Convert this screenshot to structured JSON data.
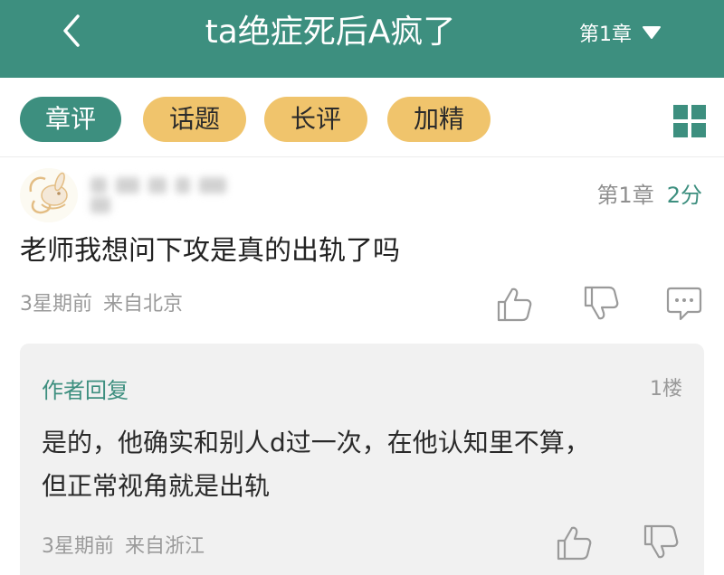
{
  "header": {
    "title": "ta绝症死后A疯了",
    "chapter_label": "第1章",
    "back_icon": "chevron-left-icon",
    "dropdown_icon": "caret-down-icon",
    "background_color": "#3d8f7f"
  },
  "filters": {
    "tabs": [
      {
        "label": "章评",
        "active": true
      },
      {
        "label": "话题",
        "active": false
      },
      {
        "label": "长评",
        "active": false
      },
      {
        "label": "加精",
        "active": false
      }
    ],
    "grid_icon": "grid-view-icon",
    "active_color": "#3d8f7f",
    "inactive_color": "#f0c46c"
  },
  "comment": {
    "chapter": "第1章",
    "score": "2分",
    "text": "老师我想问下攻是真的出轨了吗",
    "time": "3星期前",
    "location": "来自北京",
    "icons": [
      "thumbs-up-icon",
      "thumbs-down-icon",
      "comment-icon"
    ]
  },
  "reply": {
    "author_label": "作者回复",
    "floor": "1楼",
    "line1": "是的，他确实和别人d过一次，在他认知里不算，",
    "line2": "但正常视角就是出轨",
    "time": "3星期前",
    "location": "来自浙江",
    "icons": [
      "thumbs-up-icon",
      "thumbs-down-icon"
    ]
  }
}
